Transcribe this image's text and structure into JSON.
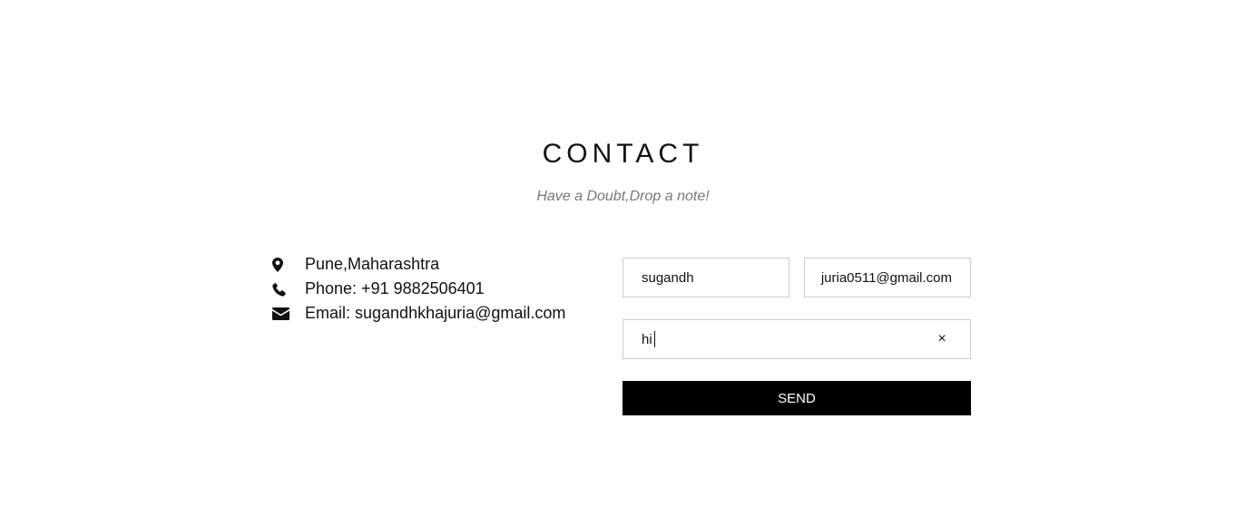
{
  "header": {
    "title": "CONTACT",
    "subtitle": "Have a Doubt,Drop a note!"
  },
  "contact_info": {
    "items": [
      {
        "icon": "map-marker-icon",
        "text": "Pune,Maharashtra"
      },
      {
        "icon": "phone-icon",
        "text": "Phone: +91 9882506401"
      },
      {
        "icon": "envelope-icon",
        "text": "Email: sugandhkhajuria@gmail.com"
      }
    ]
  },
  "form": {
    "name_value": "sugandh",
    "email_value": "juria0511@gmail.com",
    "message_value": "hi",
    "clear_label": "×",
    "send_label": "SEND"
  },
  "colors": {
    "button_bg": "#000000",
    "button_text": "#ffffff",
    "field_border": "#cccccc",
    "subtitle": "#777777"
  }
}
